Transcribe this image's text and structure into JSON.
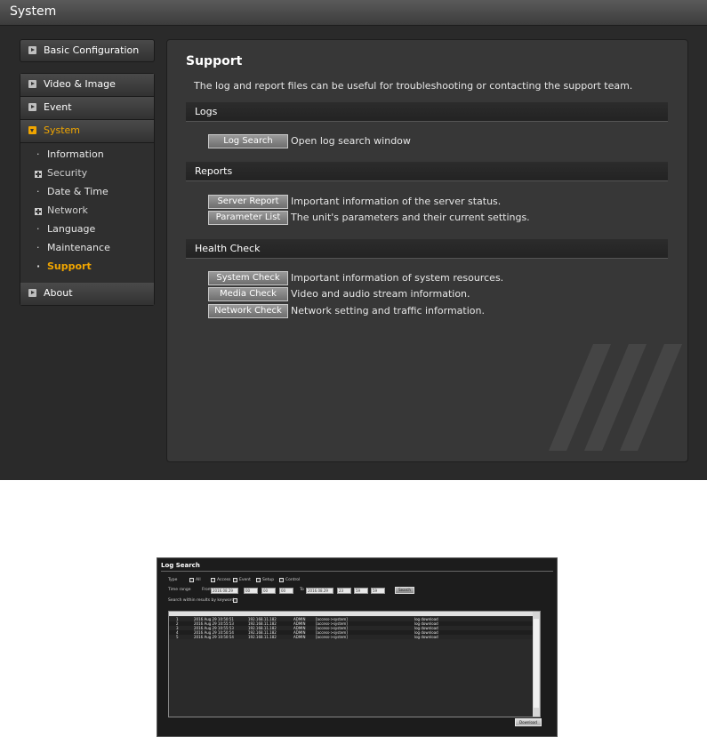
{
  "app": {
    "title": "System"
  },
  "sidebar": {
    "basic_configuration": "Basic Configuration",
    "video_image": "Video & Image",
    "event": "Event",
    "system": "System",
    "system_items": [
      {
        "label": "Information",
        "marker": "bullet"
      },
      {
        "label": "Security",
        "marker": "plus"
      },
      {
        "label": "Date & Time",
        "marker": "bullet"
      },
      {
        "label": "Network",
        "marker": "plus"
      },
      {
        "label": "Language",
        "marker": "bullet"
      },
      {
        "label": "Maintenance",
        "marker": "bullet"
      },
      {
        "label": "Support",
        "marker": "bullet",
        "active": true
      }
    ],
    "about": "About"
  },
  "main": {
    "title": "Support",
    "intro": "The log and report files can be useful for troubleshooting or contacting the support team.",
    "sections": {
      "logs": {
        "label": "Logs",
        "buttons": [
          {
            "label": "Log Search",
            "desc": "Open log search window"
          }
        ]
      },
      "reports": {
        "label": "Reports",
        "buttons": [
          {
            "label": "Server Report",
            "desc": "Important information of the server status."
          },
          {
            "label": "Parameter List",
            "desc": "The unit's parameters and their current settings."
          }
        ]
      },
      "health": {
        "label": "Health Check",
        "buttons": [
          {
            "label": "System Check",
            "desc": "Important information of system resources."
          },
          {
            "label": "Media Check",
            "desc": "Video and audio stream information."
          },
          {
            "label": "Network Check",
            "desc": "Network setting and traffic information."
          }
        ]
      }
    }
  },
  "log_search": {
    "title": "Log Search",
    "type_label": "Type",
    "types": [
      "All",
      "Access",
      "Event",
      "Setup",
      "Control"
    ],
    "time_range_label": "Time range",
    "from_label": "From",
    "to_label": "To",
    "from_date": "2016.08.29",
    "from_hh": "00",
    "from_mm": "00",
    "from_ss": "00",
    "to_date": "2016.08.29",
    "to_hh": "23",
    "to_mm": "59",
    "to_ss": "59",
    "search_button": "Search",
    "keyword_label": "Search within results by keyword",
    "rows": [
      {
        "no": "1",
        "time": "2016 Aug 29 10:50:51",
        "ip": "192.168.11.182",
        "user": "ADMIN",
        "type": "[access->system]",
        "desc": "log download"
      },
      {
        "no": "2",
        "time": "2016 Aug 29 10:55:53",
        "ip": "192.168.11.182",
        "user": "ADMIN",
        "type": "[access->system]",
        "desc": "log download"
      },
      {
        "no": "3",
        "time": "2016 Aug 29 10:55:53",
        "ip": "192.168.11.182",
        "user": "ADMIN",
        "type": "[access->system]",
        "desc": "log download"
      },
      {
        "no": "4",
        "time": "2016 Aug 29 10:50:54",
        "ip": "192.168.11.182",
        "user": "ADMIN",
        "type": "[access->system]",
        "desc": "log download"
      },
      {
        "no": "5",
        "time": "2016 Aug 29 10:50:54",
        "ip": "192.168.11.182",
        "user": "ADMIN",
        "type": "[access->system]",
        "desc": "log download"
      }
    ],
    "download_button": "Download"
  }
}
